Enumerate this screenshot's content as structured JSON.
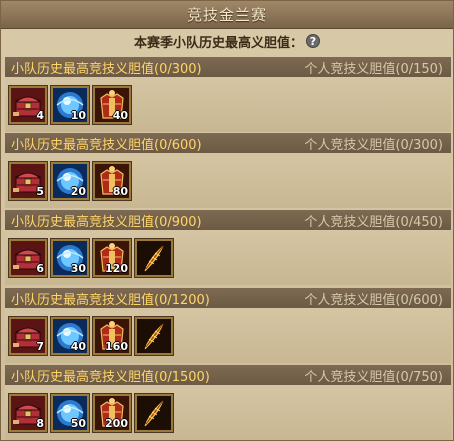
{
  "title": "竞技金兰赛",
  "subtitle": "本赛季小队历史最高义胆值：",
  "help_icon_glyph": "?",
  "colors": {
    "team_label": "#ffd56a",
    "personal_label": "#d7c8aa",
    "header_bg": "#7a6448"
  },
  "tiers": [
    {
      "team_label": "小队历史最高竞技义胆值(0/300)",
      "personal_label": "个人竞技义胆值(0/150)",
      "rewards": [
        {
          "icon": "chest-icon",
          "qty": "4"
        },
        {
          "icon": "orb-icon",
          "qty": "10"
        },
        {
          "icon": "armor-icon",
          "qty": "40"
        }
      ]
    },
    {
      "team_label": "小队历史最高竞技义胆值(0/600)",
      "personal_label": "个人竞技义胆值(0/300)",
      "rewards": [
        {
          "icon": "chest-icon",
          "qty": "5"
        },
        {
          "icon": "orb-icon",
          "qty": "20"
        },
        {
          "icon": "armor-icon",
          "qty": "80"
        }
      ]
    },
    {
      "team_label": "小队历史最高竞技义胆值(0/900)",
      "personal_label": "个人竞技义胆值(0/450)",
      "rewards": [
        {
          "icon": "chest-icon",
          "qty": "6"
        },
        {
          "icon": "orb-icon",
          "qty": "30"
        },
        {
          "icon": "armor-icon",
          "qty": "120"
        },
        {
          "icon": "feather-icon",
          "qty": ""
        }
      ]
    },
    {
      "team_label": "小队历史最高竞技义胆值(0/1200)",
      "personal_label": "个人竞技义胆值(0/600)",
      "rewards": [
        {
          "icon": "chest-icon",
          "qty": "7"
        },
        {
          "icon": "orb-icon",
          "qty": "40"
        },
        {
          "icon": "armor-icon",
          "qty": "160"
        },
        {
          "icon": "feather-icon",
          "qty": ""
        }
      ]
    },
    {
      "team_label": "小队历史最高竞技义胆值(0/1500)",
      "personal_label": "个人竞技义胆值(0/750)",
      "rewards": [
        {
          "icon": "chest-icon",
          "qty": "8"
        },
        {
          "icon": "orb-icon",
          "qty": "50"
        },
        {
          "icon": "armor-icon",
          "qty": "200"
        },
        {
          "icon": "feather-icon",
          "qty": ""
        }
      ]
    }
  ]
}
